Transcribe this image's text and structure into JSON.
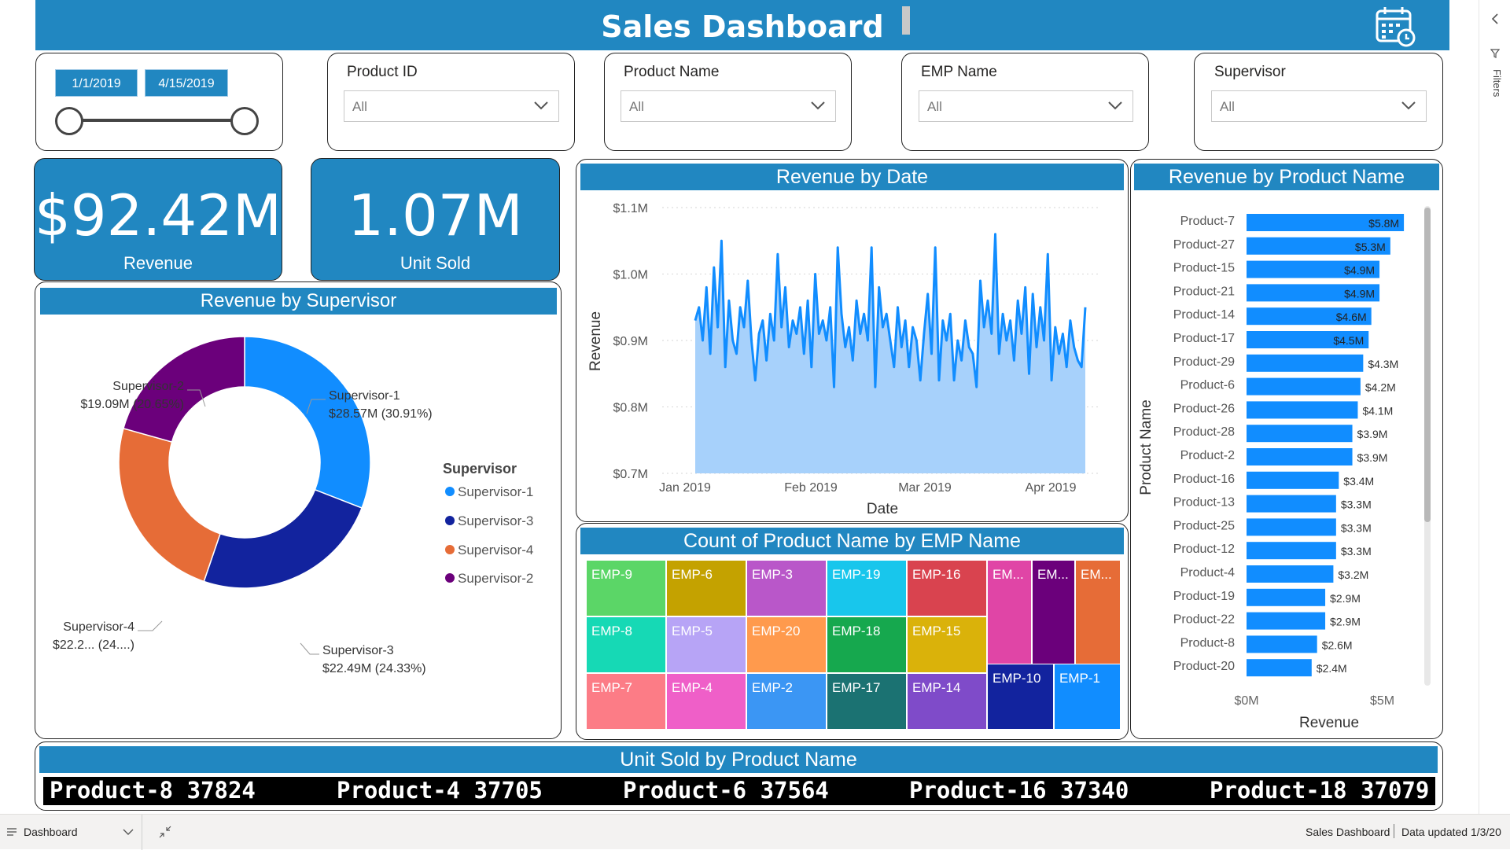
{
  "header": {
    "title": "Sales Dashboard",
    "calendar_icon": "calendar-clock-icon"
  },
  "date_slicer": {
    "start": "1/1/2019",
    "end": "4/15/2019"
  },
  "slicers": [
    {
      "label": "Product ID",
      "value": "All"
    },
    {
      "label": "Product Name",
      "value": "All"
    },
    {
      "label": "EMP Name",
      "value": "All"
    },
    {
      "label": "Supervisor",
      "value": "All"
    }
  ],
  "kpis": {
    "revenue": {
      "value": "$92.42M",
      "label": "Revenue"
    },
    "units": {
      "value": "1.07M",
      "label": "Unit Sold"
    }
  },
  "donut": {
    "title": "Revenue by Supervisor",
    "legend_title": "Supervisor",
    "slices": [
      {
        "name": "Supervisor-1",
        "value": 30.91,
        "amount": "$28.57M (30.91%)",
        "color": "#118dff"
      },
      {
        "name": "Supervisor-3",
        "value": 24.33,
        "amount": "$22.49M (24.33%)",
        "color": "#12239e"
      },
      {
        "name": "Supervisor-4",
        "value": 24.11,
        "amount": "$22.2... (24....)",
        "color": "#e66c37"
      },
      {
        "name": "Supervisor-2",
        "value": 20.65,
        "amount": "$19.09M (20.65%)",
        "color": "#6b007b"
      }
    ]
  },
  "area_chart": {
    "title": "Revenue by Date",
    "xlabel": "Date",
    "ylabel": "Revenue",
    "y_ticks": [
      "$0.7M",
      "$0.8M",
      "$0.9M",
      "$1.0M",
      "$1.1M"
    ],
    "x_ticks": [
      "Jan 2019",
      "Feb 2019",
      "Mar 2019",
      "Apr 2019"
    ]
  },
  "bar_chart": {
    "title": "Revenue by Product Name",
    "ylabel": "Product Name",
    "xlabel": "Revenue",
    "x_ticks": [
      "$0M",
      "$5M"
    ]
  },
  "treemap": {
    "title": "Count of Product Name by EMP Name",
    "cells": [
      {
        "label": "EMP-9",
        "color": "#5bd667"
      },
      {
        "label": "EMP-6",
        "color": "#c4a200"
      },
      {
        "label": "EMP-3",
        "color": "#b957c9"
      },
      {
        "label": "EMP-19",
        "color": "#18c6ec"
      },
      {
        "label": "EMP-16",
        "color": "#d9434f"
      },
      {
        "label": "EM...",
        "color": "#e045a6"
      },
      {
        "label": "EM...",
        "color": "#6b007b"
      },
      {
        "label": "EM...",
        "color": "#e66c37"
      },
      {
        "label": "EMP-8",
        "color": "#16d9b5"
      },
      {
        "label": "EMP-5",
        "color": "#b7a4f6"
      },
      {
        "label": "EMP-20",
        "color": "#ff9a4d"
      },
      {
        "label": "EMP-18",
        "color": "#16a84e"
      },
      {
        "label": "EMP-15",
        "color": "#dab20a"
      },
      {
        "label": "EMP-7",
        "color": "#fc7c86"
      },
      {
        "label": "EMP-4",
        "color": "#ef5fc8"
      },
      {
        "label": "EMP-2",
        "color": "#3b96f4"
      },
      {
        "label": "EMP-17",
        "color": "#1b7272"
      },
      {
        "label": "EMP-14",
        "color": "#7f4bc9"
      },
      {
        "label": "EMP-10",
        "color": "#12239e"
      },
      {
        "label": "EMP-1",
        "color": "#118dff"
      }
    ]
  },
  "ticker": {
    "title": "Unit Sold by Product Name",
    "items": [
      "Product-8 37824",
      "Product-4 37705",
      "Product-6 37564",
      "Product-16 37340",
      "Product-18 37079"
    ]
  },
  "footer": {
    "page_tab": "Dashboard",
    "report_name": "Sales Dashboard",
    "data_updated": "Data updated 1/3/20"
  },
  "filters_pane": {
    "label": "Filters"
  },
  "chart_data": [
    {
      "type": "area",
      "title": "Revenue by Date",
      "xlabel": "Date",
      "ylabel": "Revenue",
      "ylim": [
        0.7,
        1.1
      ],
      "x_start": "2019-01-01",
      "x_end": "2019-04-15",
      "values": [
        0.93,
        0.95,
        0.9,
        0.98,
        0.88,
        1.01,
        0.92,
        1.05,
        0.86,
        0.96,
        0.9,
        0.88,
        0.95,
        0.92,
        0.99,
        0.9,
        0.84,
        0.91,
        0.93,
        0.87,
        0.94,
        0.9,
        1.03,
        0.92,
        0.98,
        0.89,
        0.93,
        0.91,
        0.95,
        0.88,
        0.96,
        0.86,
        1.0,
        0.91,
        0.93,
        0.9,
        0.95,
        0.83,
        1.04,
        0.94,
        0.89,
        0.92,
        0.87,
        0.96,
        0.91,
        0.94,
        0.9,
        1.04,
        0.83,
        0.98,
        0.92,
        0.94,
        0.9,
        0.86,
        0.95,
        0.89,
        0.93,
        0.86,
        0.92,
        0.9,
        0.84,
        0.91,
        0.97,
        0.88,
        1.04,
        0.84,
        0.93,
        0.9,
        0.94,
        0.84,
        0.9,
        0.87,
        0.93,
        0.89,
        0.88,
        0.83,
        0.99,
        0.92,
        0.96,
        0.91,
        1.06,
        0.88,
        0.94,
        0.9,
        0.93,
        0.87,
        0.96,
        0.91,
        0.98,
        0.85,
        0.97,
        0.89,
        0.95,
        0.9,
        1.03,
        0.84,
        0.92,
        0.88,
        0.91,
        0.86,
        0.93,
        0.89,
        0.87,
        0.86,
        0.95
      ]
    },
    {
      "type": "bar",
      "title": "Revenue by Product Name",
      "ylabel": "Product Name",
      "xlabel": "Revenue",
      "xlim": [
        0,
        6
      ],
      "categories": [
        "Product-7",
        "Product-27",
        "Product-15",
        "Product-21",
        "Product-14",
        "Product-17",
        "Product-29",
        "Product-6",
        "Product-26",
        "Product-28",
        "Product-2",
        "Product-16",
        "Product-13",
        "Product-25",
        "Product-12",
        "Product-4",
        "Product-19",
        "Product-22",
        "Product-8",
        "Product-20"
      ],
      "values": [
        5.8,
        5.3,
        4.9,
        4.9,
        4.6,
        4.5,
        4.3,
        4.2,
        4.1,
        3.9,
        3.9,
        3.4,
        3.3,
        3.3,
        3.3,
        3.2,
        2.9,
        2.9,
        2.6,
        2.4
      ],
      "labels": [
        "$5.8M",
        "$5.3M",
        "$4.9M",
        "$4.9M",
        "$4.6M",
        "$4.5M",
        "$4.3M",
        "$4.2M",
        "$4.1M",
        "$3.9M",
        "$3.9M",
        "$3.4M",
        "$3.3M",
        "$3.3M",
        "$3.3M",
        "$3.2M",
        "$2.9M",
        "$2.9M",
        "$2.6M",
        "$2.4M"
      ],
      "color": "#118dff"
    },
    {
      "type": "pie",
      "title": "Revenue by Supervisor",
      "categories": [
        "Supervisor-1",
        "Supervisor-3",
        "Supervisor-4",
        "Supervisor-2"
      ],
      "values": [
        30.91,
        24.33,
        24.11,
        20.65
      ]
    }
  ]
}
